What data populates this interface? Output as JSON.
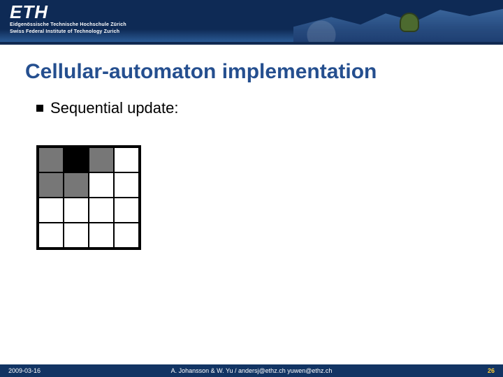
{
  "header": {
    "logo_text": "ETH",
    "logo_sub_line1": "Eidgenössische Technische Hochschule Zürich",
    "logo_sub_line2": "Swiss Federal Institute of Technology Zurich"
  },
  "title": "Cellular-automaton implementation",
  "bullets": [
    {
      "text": "Sequential update:"
    }
  ],
  "grid": {
    "rows": 4,
    "cols": 4,
    "cells": [
      [
        "grey",
        "black",
        "grey",
        "white"
      ],
      [
        "grey",
        "grey",
        "white",
        "white"
      ],
      [
        "white",
        "white",
        "white",
        "white"
      ],
      [
        "white",
        "white",
        "white",
        "white"
      ]
    ]
  },
  "footer": {
    "date": "2009-03-16",
    "authors": "A. Johansson & W. Yu / andersj@ethz.ch yuwen@ethz.ch",
    "page": "26"
  }
}
